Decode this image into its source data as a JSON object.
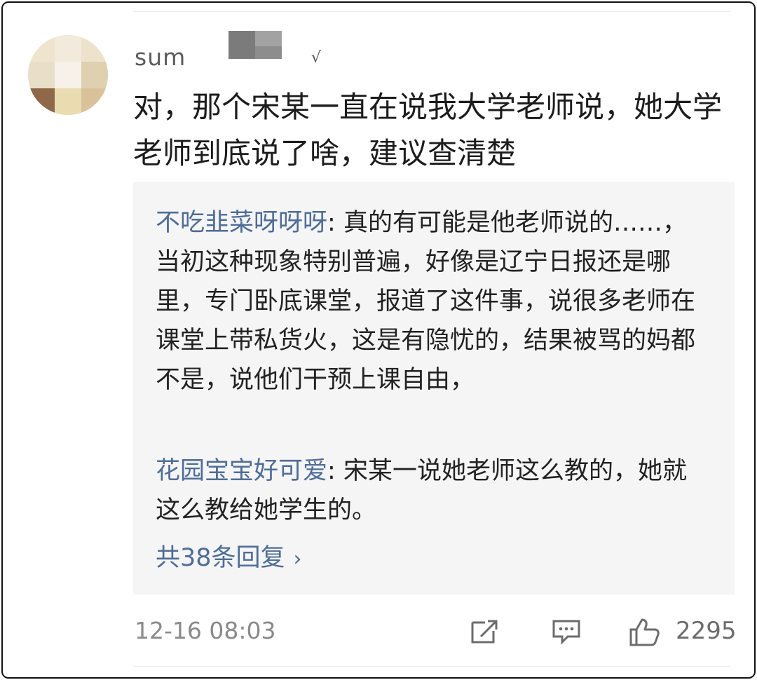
{
  "comment": {
    "username_visible": "sum",
    "verified_mark": "√",
    "text": "对，那个宋某一直在说我大学老师说，她大学老师到底说了啥，建议查清楚",
    "timestamp": "12-16 08:03",
    "like_count": "2295"
  },
  "replies": [
    {
      "author": "不吃韭菜呀呀呀",
      "text": "真的有可能是他老师说的……，当初这种现象特别普遍，好像是辽宁日报还是哪里，专门卧底课堂，报道了这件事，说很多老师在课堂上带私货火，这是有隐忧的，结果被骂的妈都不是，说他们干预上课自由，"
    },
    {
      "author": "花园宝宝好可爱",
      "text": "宋某一说她老师这么教的，她就这么教给她学生的。"
    }
  ],
  "more_replies": {
    "label": "共38条回复",
    "chevron": "›"
  },
  "actions": {
    "share_icon": "share-icon",
    "reply_icon": "comment-icon",
    "like_icon": "thumbs-up-icon"
  },
  "colors": {
    "reply_author": "#4f6d97",
    "reply_background": "#f5f5f5",
    "meta_text": "#8a8a8a"
  }
}
